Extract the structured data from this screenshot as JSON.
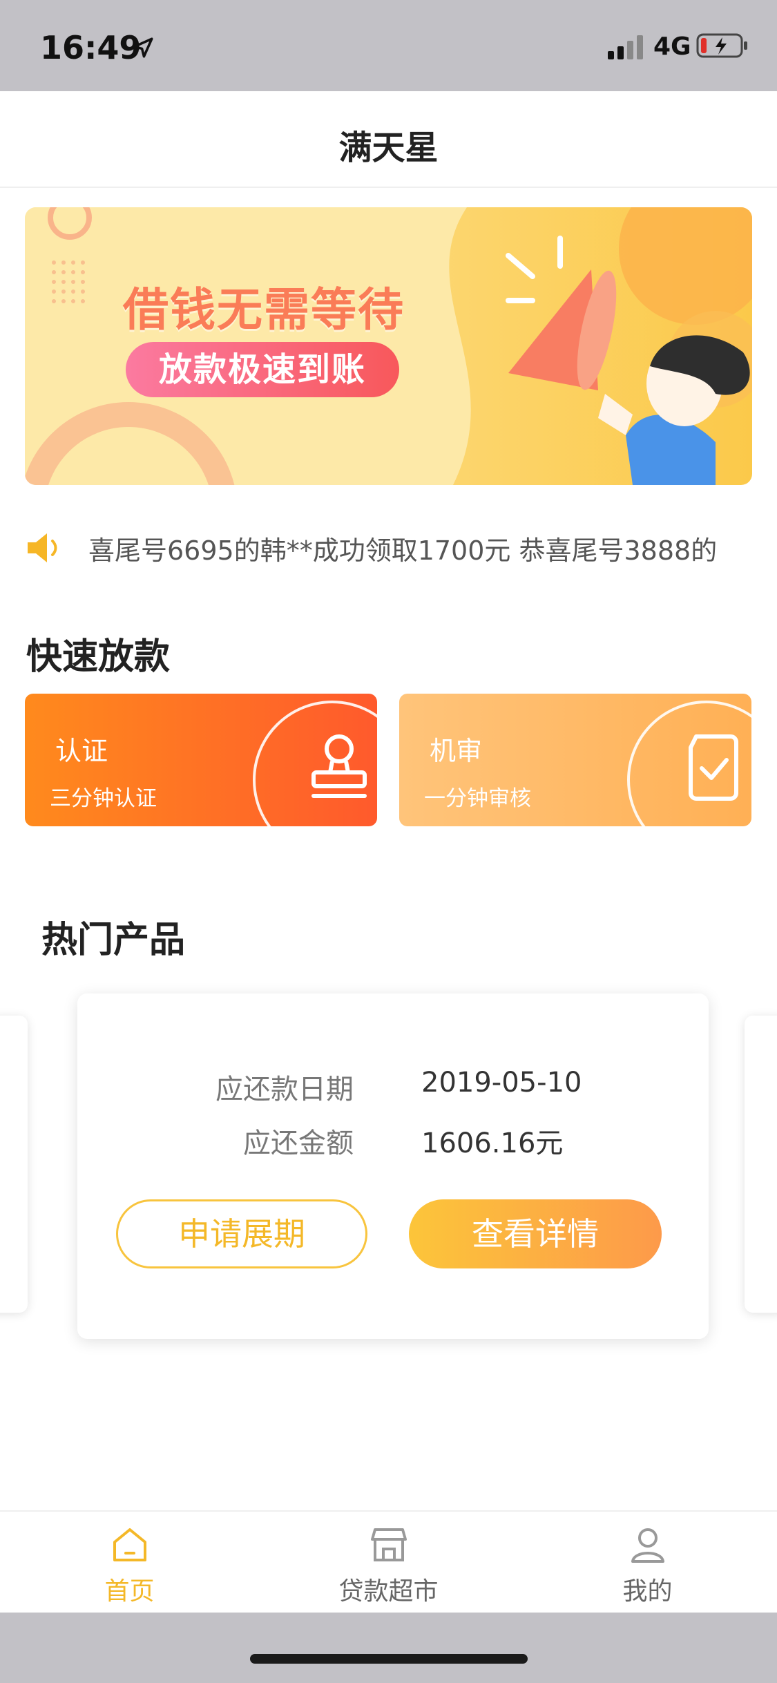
{
  "status_bar": {
    "time": "16:49",
    "network": "4G"
  },
  "nav": {
    "title": "满天星"
  },
  "banner": {
    "headline": "借钱无需等待",
    "pill_text": "放款极速到账"
  },
  "notice": {
    "text": "喜尾号6695的韩**成功领取1700元 恭喜尾号3888的"
  },
  "quick_section": {
    "title": "快速放款",
    "cards": [
      {
        "title": "认证",
        "subtitle": "三分钟认证",
        "icon": "stamp-icon"
      },
      {
        "title": "机审",
        "subtitle": "一分钟审核",
        "icon": "document-check-icon"
      }
    ]
  },
  "hot_section": {
    "title": "热门产品"
  },
  "product": {
    "due_date_label": "应还款日期",
    "due_date_value": "2019-05-10",
    "amount_label": "应还金额",
    "amount_value": "1606.16元",
    "extend_button": "申请展期",
    "detail_button": "查看详情"
  },
  "tabbar": {
    "items": [
      {
        "label": "首页",
        "icon": "home-icon",
        "active": true
      },
      {
        "label": "贷款超市",
        "icon": "store-icon",
        "active": false
      },
      {
        "label": "我的",
        "icon": "user-icon",
        "active": false
      }
    ]
  },
  "colors": {
    "accent": "#f4b828",
    "orange": "#ff6a2a"
  }
}
